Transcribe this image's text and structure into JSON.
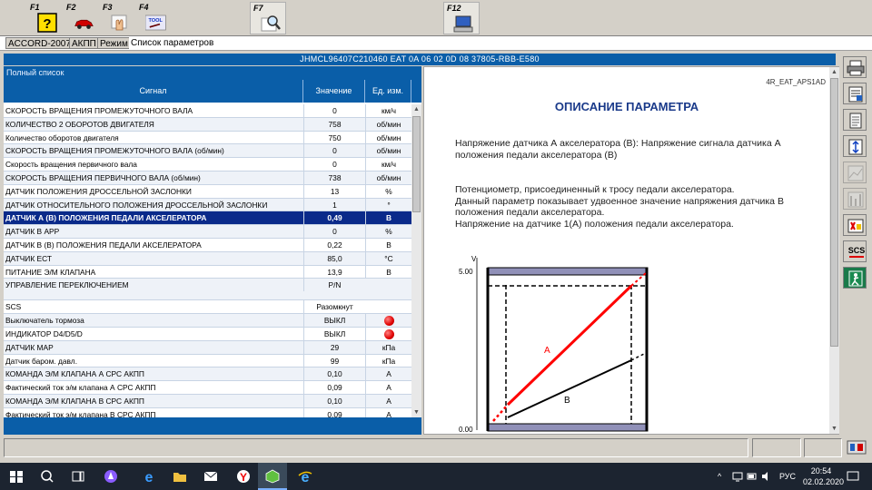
{
  "toolbar": {
    "keys": [
      {
        "label": "F1",
        "icon": "help-question-icon"
      },
      {
        "label": "F2",
        "icon": "car-icon"
      },
      {
        "label": "F3",
        "icon": "hand-icon"
      },
      {
        "label": "F4",
        "icon": "tool-icon",
        "icon_text": "TOOL"
      },
      {
        "label": "F7",
        "icon": "magnifier-icon"
      },
      {
        "label": "F12",
        "icon": "computer-icon"
      }
    ]
  },
  "breadcrumb": {
    "items": [
      "ACCORD-2007",
      "АКПП",
      "Режим"
    ],
    "active": "Список параметров"
  },
  "vin_bar": "JHMCL96407C210460  EAT  0A 06 02 0D 08  37805-RBB-E580",
  "list": {
    "title": "Полный список",
    "columns": [
      "Сигнал",
      "Значение",
      "Ед. изм."
    ],
    "rows": [
      {
        "signal": "СКОРОСТЬ ВРАЩЕНИЯ ПРОМЕЖУТОЧНОГО ВАЛА",
        "value": "0",
        "unit": "км/ч"
      },
      {
        "signal": "КОЛИЧЕСТВО 2 ОБОРОТОВ ДВИГАТЕЛЯ",
        "value": "758",
        "unit": "об/мин"
      },
      {
        "signal": "Количество оборотов двигателя",
        "value": "750",
        "unit": "об/мин"
      },
      {
        "signal": "СКОРОСТЬ ВРАЩЕНИЯ ПРОМЕЖУТОЧНОГО ВАЛА (об/мин)",
        "value": "0",
        "unit": "об/мин"
      },
      {
        "signal": "Скорость вращения первичного вала",
        "value": "0",
        "unit": "км/ч"
      },
      {
        "signal": "СКОРОСТЬ ВРАЩЕНИЯ ПЕРВИЧНОГО ВАЛА (об/мин)",
        "value": "738",
        "unit": "об/мин"
      },
      {
        "signal": "ДАТЧИК ПОЛОЖЕНИЯ ДРОССЕЛЬНОЙ ЗАСЛОНКИ",
        "value": "13",
        "unit": "%"
      },
      {
        "signal": "ДАТЧИК ОТНОСИТЕЛЬНОГО ПОЛОЖЕНИЯ ДРОССЕЛЬНОЙ ЗАСЛОНКИ",
        "value": "1",
        "unit": "°"
      },
      {
        "signal": "ДАТЧИК А (В) ПОЛОЖЕНИЯ ПЕДАЛИ АКСЕЛЕРАТОРА",
        "value": "0,49",
        "unit": "В",
        "selected": true
      },
      {
        "signal": "ДАТЧИК В APP",
        "value": "0",
        "unit": "%"
      },
      {
        "signal": "ДАТЧИК В (В) ПОЛОЖЕНИЯ ПЕДАЛИ АКСЕЛЕРАТОРА",
        "value": "0,22",
        "unit": "В"
      },
      {
        "signal": "ДАТЧИК ЕСТ",
        "value": "85,0",
        "unit": "°C"
      },
      {
        "signal": "ПИТАНИЕ Э/М КЛАПАНА",
        "value": "13,9",
        "unit": "В"
      },
      {
        "signal": "УПРАВЛЕНИЕ ПЕРЕКЛЮЧЕНИЕМ",
        "value": "P/N",
        "unit": "",
        "tall": true
      },
      {
        "signal": "SCS",
        "value": "Разомкнут",
        "unit": ""
      },
      {
        "signal": "Выключатель тормоза",
        "value": "ВЫКЛ",
        "unit": "",
        "indicator": true
      },
      {
        "signal": "ИНДИКАТОР D4/D5/D",
        "value": "ВЫКЛ",
        "unit": "",
        "indicator": true
      },
      {
        "signal": "ДАТЧИК МАР",
        "value": "29",
        "unit": "кПа"
      },
      {
        "signal": "Датчик баром. давл.",
        "value": "99",
        "unit": "кПа"
      },
      {
        "signal": "КОМАНДА Э/М КЛАПАНА А СРС АКПП",
        "value": "0,10",
        "unit": "А"
      },
      {
        "signal": "Фактический ток э/м клапана А СРС АКПП",
        "value": "0,09",
        "unit": "А"
      },
      {
        "signal": "КОМАНДА Э/М КЛАПАНА В СРС АКПП",
        "value": "0,10",
        "unit": "А"
      },
      {
        "signal": "Фактический ток э/м клапана В СРС АКПП",
        "value": "0,09",
        "unit": "А"
      }
    ]
  },
  "description": {
    "code": "4R_EAT_APS1AD",
    "title": "ОПИСАНИЕ ПАРАМЕТРА",
    "para1": "Напряжение датчика А акселератора (В): Напряжение сигнала датчика А положения педали акселератора (В)",
    "para2_lines": [
      "Потенциометр, присоединенный к тросу педали акселератора.",
      "Данный параметр показывает удвоенное значение напряжения датчика В положения педали акселератора.",
      "Напряжение на датчике 1(А) положения педали акселератора."
    ]
  },
  "graph": {
    "y_unit": "V",
    "y_ticks": [
      "5.00",
      "0.00"
    ],
    "line_a_label": "A",
    "line_b_label": "B",
    "line_a_color": "#ff0000",
    "line_b_color": "#000000"
  },
  "sidebar": {
    "buttons": [
      "print-icon",
      "settings-list-icon",
      "document-icon",
      "expand-vertical-icon",
      "graph-disabled-icon",
      "graph-scale-disabled-icon",
      "freeze-frame-icon",
      "scs-icon",
      "exit-icon"
    ],
    "scs_text": "SCS"
  },
  "taskbar": {
    "lang": "РУС",
    "time": "20:54",
    "date": "02.02.2020"
  }
}
